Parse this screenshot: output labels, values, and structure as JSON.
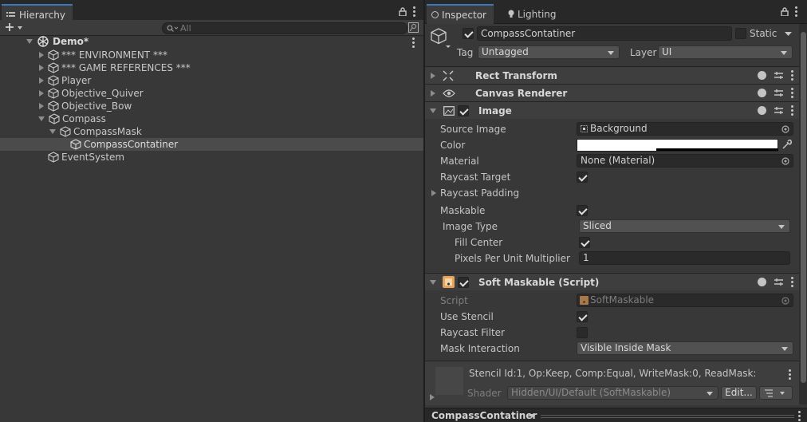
{
  "hierarchy": {
    "tab_label": "Hierarchy",
    "search_placeholder": "All",
    "scene_name": "Demo*",
    "items": [
      {
        "label": "*** ENVIRONMENT ***"
      },
      {
        "label": "*** GAME REFERENCES ***"
      },
      {
        "label": "Player"
      },
      {
        "label": "Objective_Quiver"
      },
      {
        "label": "Objective_Bow"
      },
      {
        "label": "Compass"
      },
      {
        "label": "CompassMask"
      },
      {
        "label": "CompassContatiner"
      },
      {
        "label": "EventSystem"
      }
    ]
  },
  "inspector": {
    "tabs": [
      {
        "label": "Inspector"
      },
      {
        "label": "Lighting"
      }
    ],
    "object_name": "CompassContatiner",
    "static_label": "Static",
    "tag_label": "Tag",
    "tag_value": "Untagged",
    "layer_label": "Layer",
    "layer_value": "UI",
    "components": {
      "rect_transform": "Rect Transform",
      "canvas_renderer": "Canvas Renderer",
      "image": "Image",
      "soft_maskable": "Soft Maskable (Script)"
    },
    "image": {
      "source_image_label": "Source Image",
      "source_image_value": "Background",
      "color_label": "Color",
      "material_label": "Material",
      "material_value": "None (Material)",
      "raycast_target_label": "Raycast Target",
      "raycast_padding_label": "Raycast Padding",
      "maskable_label": "Maskable",
      "image_type_label": "Image Type",
      "image_type_value": "Sliced",
      "fill_center_label": "Fill Center",
      "ppu_label": "Pixels Per Unit Multiplier",
      "ppu_value": "1"
    },
    "soft_maskable": {
      "script_label": "Script",
      "script_value": "SoftMaskable",
      "use_stencil_label": "Use Stencil",
      "raycast_filter_label": "Raycast Filter",
      "mask_interaction_label": "Mask Interaction",
      "mask_interaction_value": "Visible Inside Mask"
    },
    "material_preview": {
      "info": "Stencil Id:1, Op:Keep, Comp:Equal, WriteMask:0, ReadMask:",
      "shader_label": "Shader",
      "shader_value": "Hidden/UI/Default (SoftMaskable)",
      "edit_label": "Edit..."
    },
    "footer_label": "CompassContatiner"
  },
  "colors": {
    "panel_bg": "#383838",
    "tab_accent": "#3a79bb",
    "selected_row": "#4b4b4b"
  },
  "checkbox_state": {
    "object_active": true,
    "static": false,
    "image_enabled": true,
    "raycast_target": true,
    "maskable": true,
    "fill_center": true,
    "soft_maskable_enabled": true,
    "use_stencil": true,
    "raycast_filter": false
  }
}
